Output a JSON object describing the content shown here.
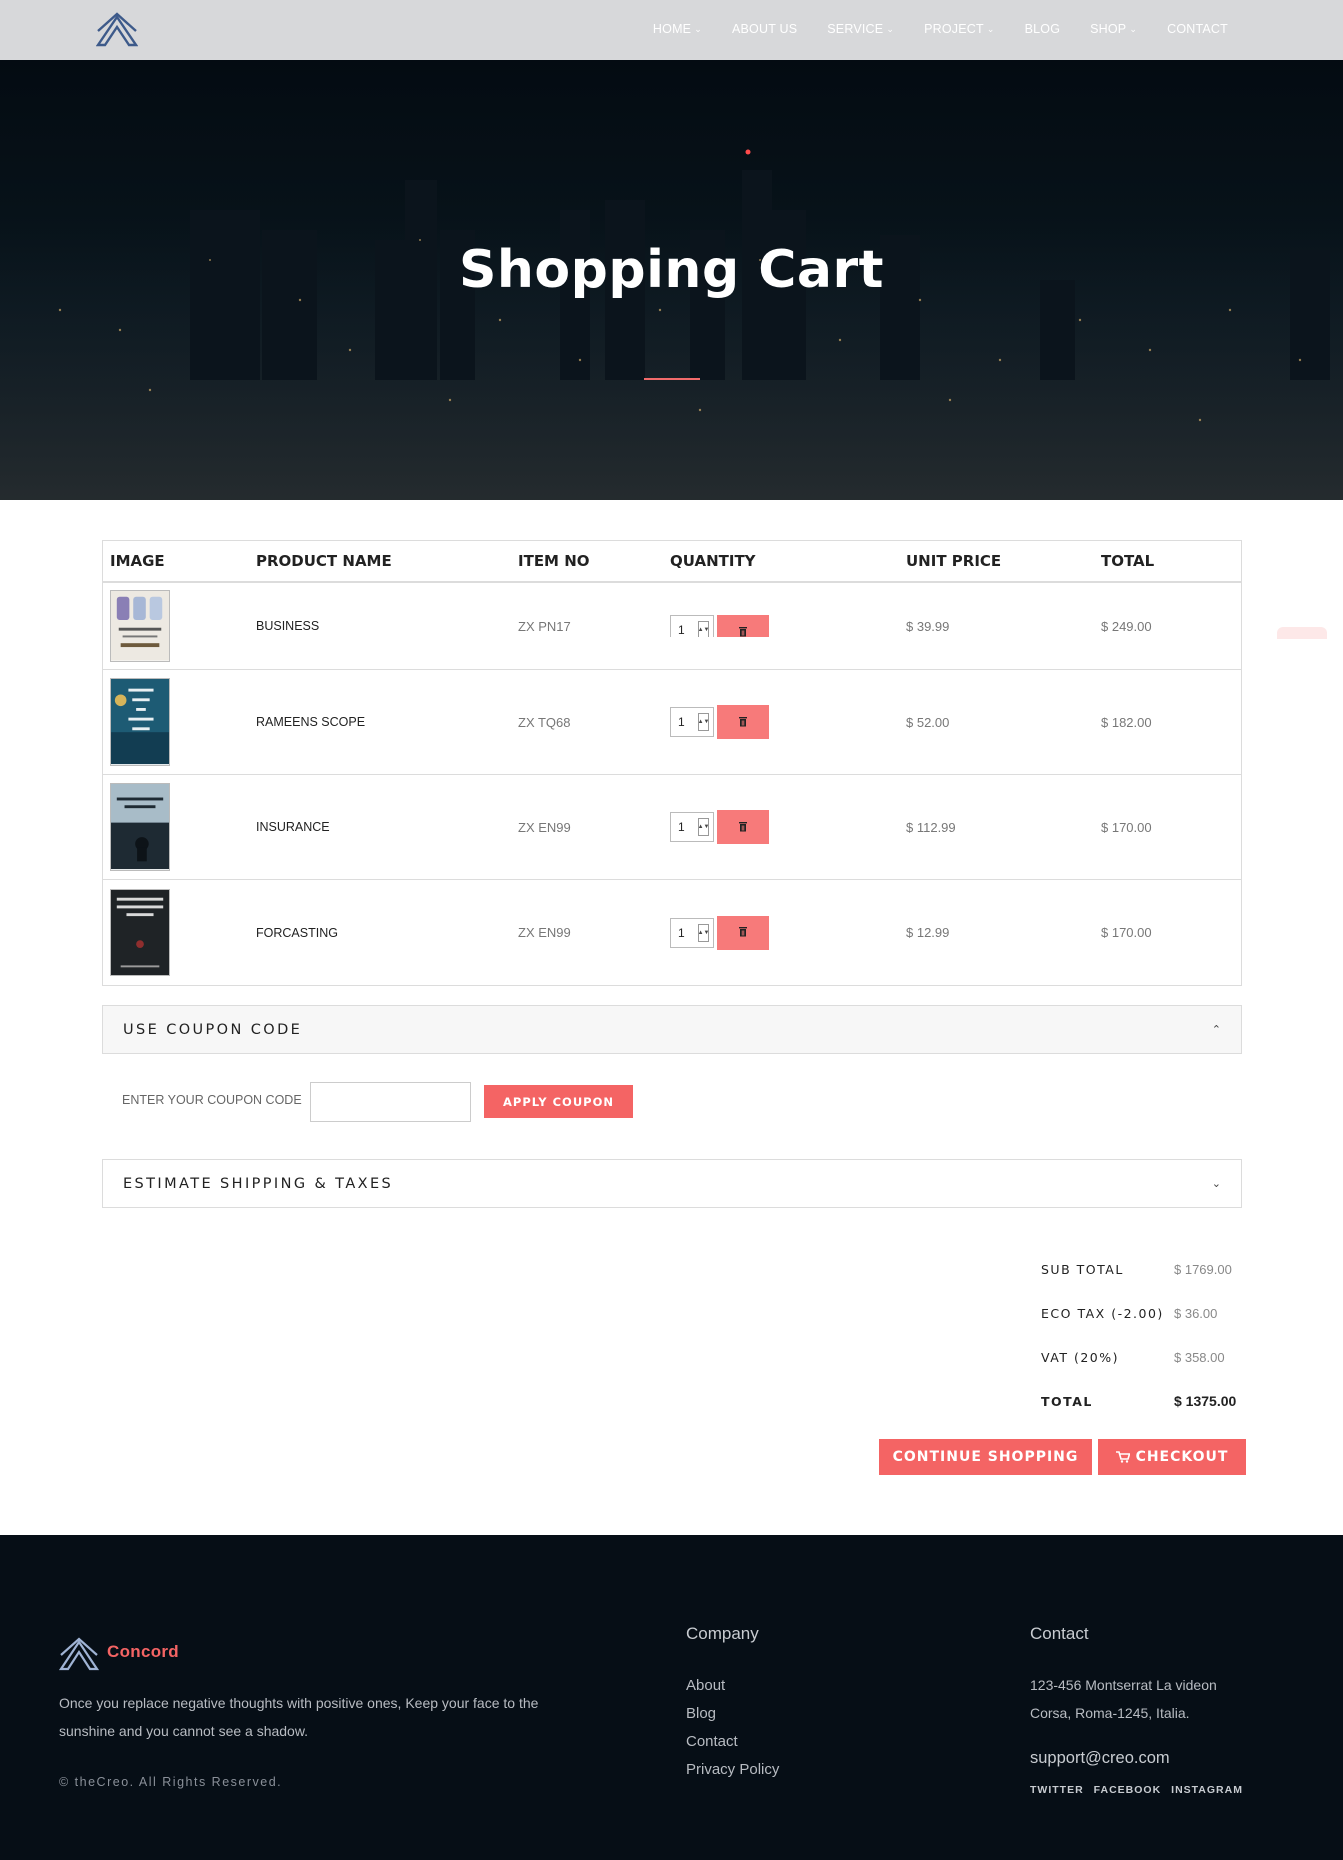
{
  "nav": {
    "items": [
      {
        "label": "HOME",
        "has_dropdown": true
      },
      {
        "label": "ABOUT US",
        "has_dropdown": false
      },
      {
        "label": "SERVICE",
        "has_dropdown": true
      },
      {
        "label": "PROJECT",
        "has_dropdown": true
      },
      {
        "label": "BLOG",
        "has_dropdown": false
      },
      {
        "label": "SHOP",
        "has_dropdown": true
      },
      {
        "label": "CONTACT",
        "has_dropdown": false
      }
    ]
  },
  "hero": {
    "title": "Shopping Cart"
  },
  "cart": {
    "headers": {
      "image": "IMAGE",
      "name": "PRODUCT NAME",
      "item_no": "ITEM NO",
      "quantity": "QUANTITY",
      "unit_price": "UNIT PRICE",
      "total": "TOTAL"
    },
    "rows": [
      {
        "name": "BUSINESS",
        "item_no": "ZX PN17",
        "qty": "1",
        "unit_price": "$ 39.99",
        "total": "$ 249.00",
        "cover": "#e8e3dc"
      },
      {
        "name": "RAMEENS SCOPE",
        "item_no": "ZX TQ68",
        "qty": "1",
        "unit_price": "$ 52.00",
        "total": "$ 182.00",
        "cover": "#1d5b74"
      },
      {
        "name": "INSURANCE",
        "item_no": "ZX EN99",
        "qty": "1",
        "unit_price": "$ 112.99",
        "total": "$ 170.00",
        "cover": "#3b4d5c"
      },
      {
        "name": "FORCASTING",
        "item_no": "ZX EN99",
        "qty": "1",
        "unit_price": "$ 12.99",
        "total": "$ 170.00",
        "cover": "#1f2326"
      }
    ]
  },
  "coupon": {
    "panel_label": "USE COUPON CODE",
    "field_label": "ENTER YOUR COUPON CODE",
    "input_value": "",
    "apply_label": "APPLY COUPON"
  },
  "shipping": {
    "panel_label": "ESTIMATE SHIPPING & TAXES"
  },
  "totals": [
    {
      "label": "SUB TOTAL",
      "value": "$ 1769.00"
    },
    {
      "label": "ECO TAX (-2.00)",
      "value": "$ 36.00"
    },
    {
      "label": "VAT (20%)",
      "value": "$ 358.00"
    },
    {
      "label": "TOTAL",
      "value": "$ 1375.00"
    }
  ],
  "actions": {
    "continue_label": "CONTINUE SHOPPING",
    "checkout_label": "CHECKOUT"
  },
  "footer": {
    "brand": "Concord",
    "text": "Once you replace negative thoughts with positive ones, Keep your face to the sunshine and you cannot see a shadow.",
    "copyright": "© theCreo. All Rights Reserved.",
    "company_heading": "Company",
    "company_links": [
      "About",
      "Blog",
      "Contact",
      "Privacy Policy"
    ],
    "contact_heading": "Contact",
    "address_line1": "123-456 Montserrat La videon",
    "address_line2": "Corsa, Roma-1245, Italia.",
    "email": "support@creo.com",
    "social": [
      "TWITTER",
      "FACEBOOK",
      "INSTAGRAM"
    ]
  },
  "colors": {
    "accent": "#f46464",
    "nav_bg": "#d7d8da",
    "footer_bg": "#060e16",
    "delete_btn": "#f77a7a"
  }
}
